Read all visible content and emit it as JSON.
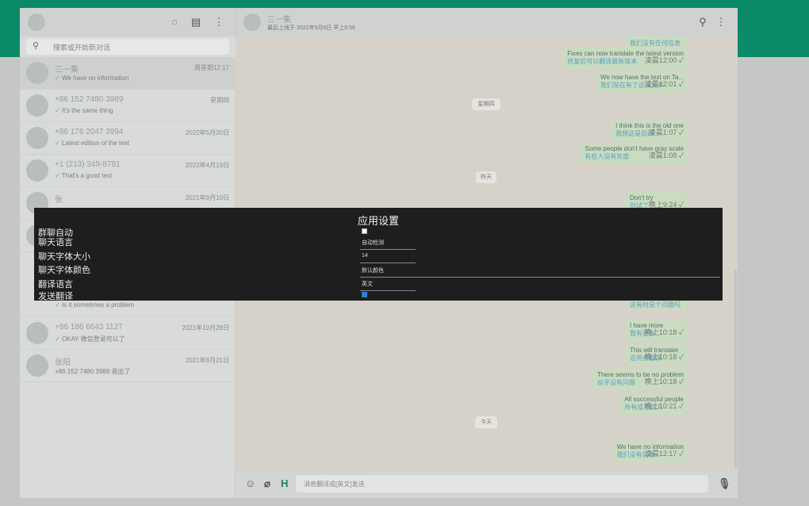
{
  "left_header": {
    "status_icon": "status-circle-icon",
    "new_chat_icon": "chat-icon",
    "menu_icon": "dots-vertical-icon"
  },
  "search": {
    "placeholder": "搜索或开始新对话",
    "icon": "search-icon"
  },
  "chats": [
    {
      "name": "三一集",
      "date": "周星期12:17",
      "last": "We have no information",
      "tick": "✓"
    },
    {
      "name": "+86 152 7480 3989",
      "date": "星期四",
      "last": "It's the same thing",
      "tick": "✓"
    },
    {
      "name": "+86 176 2047 3994",
      "date": "2022年5月20日",
      "last": "Latest edition of the text",
      "tick": "✓"
    },
    {
      "name": "+1 (213) 349-8781",
      "date": "2022年4月19日",
      "last": "That's a good text",
      "tick": "✓"
    },
    {
      "name": "张",
      "date": "2021年9月10日",
      "last": "",
      "tick": ""
    },
    {
      "name": "",
      "date": "",
      "last": "",
      "tick": ""
    },
    {
      "name": "",
      "date": "",
      "last": "Is it sometimes a problem",
      "tick": "✓"
    },
    {
      "name": "+86 186 6643 1127",
      "date": "2021年10月28日",
      "last": "OKAY 微信登录可以了",
      "tick": "✓"
    },
    {
      "name": "张阳",
      "date": "2021年8月21日",
      "last": "+86 152 7480 3989 退出了",
      "tick": ""
    }
  ],
  "conversation": {
    "name": "三一集",
    "last_seen": "最后上线于 2022年5月6日 早上6:56",
    "search_icon": "search-icon",
    "menu_icon": "dots-vertical-icon"
  },
  "messages": [
    {
      "en": "",
      "zh": "我们没有任何信息",
      "time": ""
    },
    {
      "en": "Fixes can now translate the latest version",
      "zh": "修复后可以翻译最新版本",
      "time": "凌晨12:00"
    },
    {
      "en": "We now have the text on Ta...",
      "zh": "我们现在有了这段文本",
      "time": "凌晨12:01"
    },
    {
      "en": "I think this is the old one",
      "zh": "我想这是旧的",
      "time": "凌晨1:07"
    },
    {
      "en": "Some people don't have gray scale",
      "zh": "有些人没有灰度",
      "time": "凌晨1:08"
    },
    {
      "en": "Don't try",
      "zh": "别试了",
      "time": "晚上9:24"
    },
    {
      "en": "",
      "zh": "这有时是个问题吗",
      "time": ""
    },
    {
      "en": "I have more",
      "zh": "我有更多",
      "time": "晚上10:18"
    },
    {
      "en": "This will translate",
      "zh": "这将会翻译",
      "time": "晚上10:18"
    },
    {
      "en": "There seems to be no problem",
      "zh": "似乎没有问题",
      "time": "晚上10:18"
    },
    {
      "en": "All successful people",
      "zh": "所有成功的人",
      "time": "晚上10:21"
    },
    {
      "en": "We have no information",
      "zh": "我们没有信息",
      "time": "凌晨12:17"
    }
  ],
  "date_chips": [
    "星期四",
    "昨天",
    "今天"
  ],
  "composer": {
    "placeholder": "消息翻译成[英文]发送",
    "emoji_icon": "emoji-icon",
    "attach_icon": "paperclip-icon",
    "h_label": "H",
    "mic_icon": "microphone-icon"
  },
  "settings": {
    "title": "应用设置",
    "rows": [
      {
        "label": "群聊自动",
        "value": ""
      },
      {
        "label": "聊天语言",
        "value": "自动检测"
      },
      {
        "label": "聊天字体大小",
        "value": "14"
      },
      {
        "label": "聊天字体颜色",
        "value": "默认颜色"
      },
      {
        "label": "翻译语言",
        "value": "英文"
      },
      {
        "label": "发送翻译",
        "value": ""
      }
    ],
    "group_auto_checked": false,
    "send_translate_checked": true
  }
}
